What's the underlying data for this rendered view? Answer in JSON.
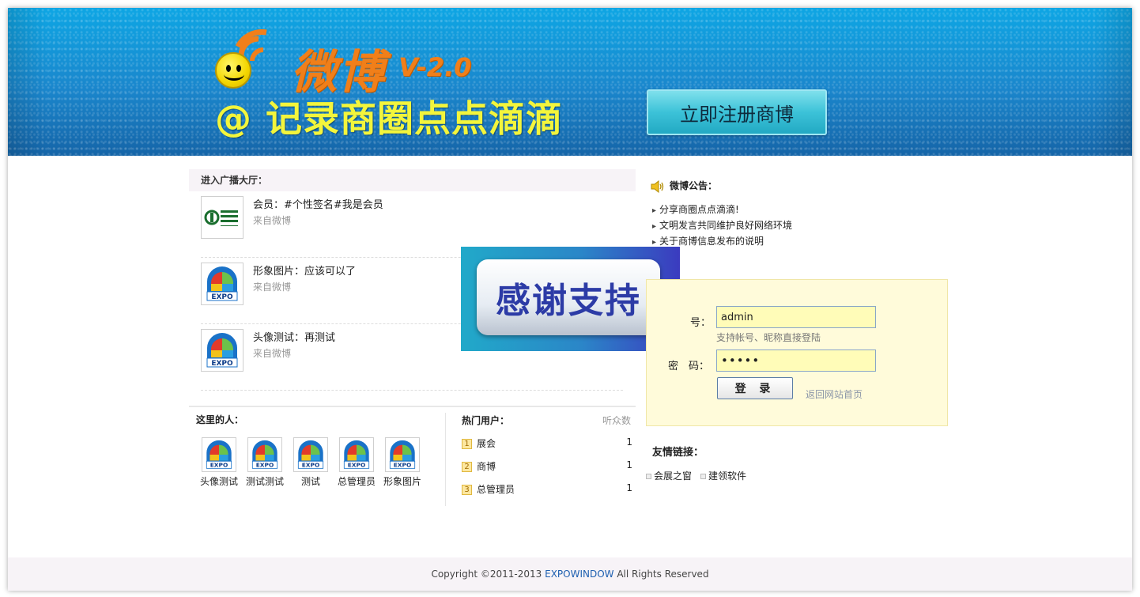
{
  "banner": {
    "logo_text": "微博",
    "version": "V-2.0",
    "slogan": "@ 记录商圈点点滴滴",
    "register_label": "立即注册商博"
  },
  "hall": {
    "title": "进入广播大厅：",
    "posts": [
      {
        "text": "会员：#个性签名#我是会员",
        "source": "来自微博",
        "avatar": "bank-logo"
      },
      {
        "text": "形象图片：应该可以了",
        "source": "来自微博",
        "avatar": "expo-logo"
      },
      {
        "text": "头像测试：再测试",
        "source": "来自微博",
        "avatar": "expo-logo"
      }
    ]
  },
  "overlay": {
    "text": "感谢支持"
  },
  "people": {
    "title": "这里的人：",
    "items": [
      "头像测试",
      "测试测试",
      "测试",
      "总管理员",
      "形象图片"
    ]
  },
  "hot_users": {
    "title": "热门用户：",
    "column": "听众数",
    "rows": [
      {
        "rank": "1",
        "name": "展会",
        "count": "1"
      },
      {
        "rank": "2",
        "name": "商博",
        "count": "1"
      },
      {
        "rank": "3",
        "name": "总管理员",
        "count": "1"
      }
    ]
  },
  "notice": {
    "title": "微博公告：",
    "items": [
      "分享商圈点点滴滴!",
      "文明发言共同维护良好网络环境",
      "关于商博信息发布的说明"
    ]
  },
  "login": {
    "account_label": "号：",
    "account_value": "admin",
    "hint": "支持帐号、昵称直接登陆",
    "password_label": "密　码：",
    "password_value": "•••••",
    "submit_label": "登 录",
    "back_link": "返回网站首页"
  },
  "links": {
    "title": "友情链接：",
    "items": [
      "会展之窗",
      "建领软件"
    ]
  },
  "footer": {
    "prefix": "Copyright ©2011-2013 ",
    "brand": "EXPOWINDOW",
    "suffix": " All Rights Reserved"
  },
  "colors": {
    "banner_top": "#0ea6e4",
    "banner_bottom": "#1565a8",
    "logo_orange": "#f07f1a",
    "slogan_yellow": "#f3f53c",
    "login_bg": "#fffbda"
  }
}
